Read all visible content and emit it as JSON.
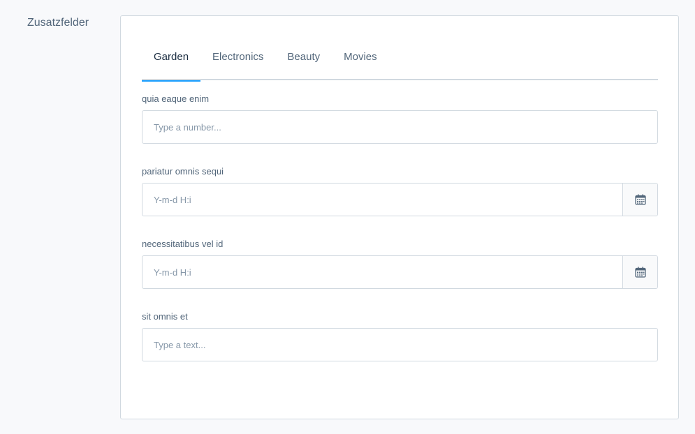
{
  "section": {
    "title": "Zusatzfelder"
  },
  "tabs": [
    {
      "label": "Garden",
      "active": true
    },
    {
      "label": "Electronics",
      "active": false
    },
    {
      "label": "Beauty",
      "active": false
    },
    {
      "label": "Movies",
      "active": false
    }
  ],
  "fields": [
    {
      "label": "quia eaque enim",
      "placeholder": "Type a number...",
      "type": "number"
    },
    {
      "label": "pariatur omnis sequi",
      "placeholder": "Y-m-d H:i",
      "type": "datetime",
      "suffix_icon": "calendar-icon"
    },
    {
      "label": "necessitatibus vel id",
      "placeholder": "Y-m-d H:i",
      "type": "datetime",
      "suffix_icon": "calendar-icon"
    },
    {
      "label": "sit omnis et",
      "placeholder": "Type a text...",
      "type": "text"
    }
  ],
  "colors": {
    "accent": "#189eff",
    "text": "#52667a",
    "border": "#d1d9e0"
  }
}
